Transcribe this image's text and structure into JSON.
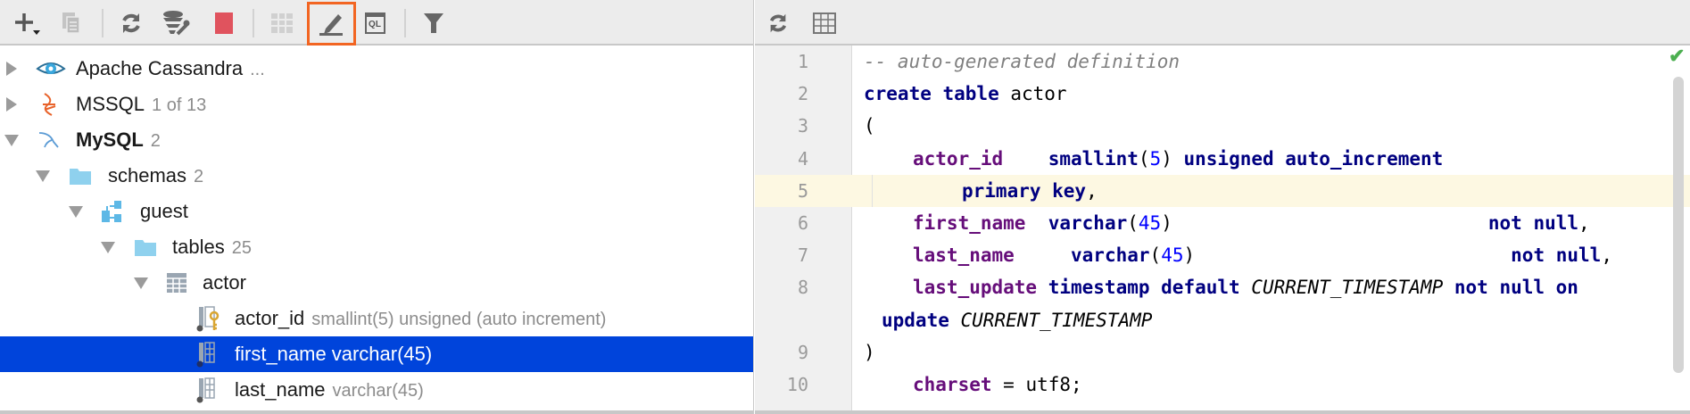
{
  "left_toolbar": {
    "buttons": [
      {
        "name": "add",
        "icon": "plus-icon"
      },
      {
        "name": "duplicate",
        "icon": "copy-icon"
      },
      {
        "name": "refresh",
        "icon": "refresh-icon"
      },
      {
        "name": "data-source-properties",
        "icon": "database-wrench-icon"
      },
      {
        "name": "stop",
        "icon": "stop-icon"
      },
      {
        "name": "table-view",
        "icon": "table-icon"
      },
      {
        "name": "edit-source",
        "icon": "pencil-icon",
        "highlighted": true
      },
      {
        "name": "console",
        "icon": "ql-console-icon",
        "label": "QL"
      },
      {
        "name": "filter",
        "icon": "filter-icon"
      }
    ],
    "highlight_color": "#f26522"
  },
  "tree": [
    {
      "label": "Apache Cassandra",
      "extra": "...",
      "icon": "cassandra-eye-icon",
      "expanded": false
    },
    {
      "label": "MSSQL",
      "extra": "1 of 13",
      "icon": "mssql-icon",
      "expanded": false
    },
    {
      "label": "MySQL",
      "extra": "2",
      "icon": "mysql-dolphin-icon",
      "expanded": true
    },
    {
      "label": "schemas",
      "extra": "2",
      "icon": "folder-icon",
      "expanded": true
    },
    {
      "label": "guest",
      "extra": "",
      "icon": "schema-icon",
      "expanded": true
    },
    {
      "label": "tables",
      "extra": "25",
      "icon": "folder-icon",
      "expanded": true
    },
    {
      "label": "actor",
      "extra": "",
      "icon": "table-icon",
      "expanded": true
    },
    {
      "label": "actor_id",
      "extra": "smallint(5) unsigned (auto increment)",
      "icon": "primary-key-column-icon"
    },
    {
      "label": "first_name",
      "extra": "varchar(45)",
      "icon": "column-icon",
      "selected": true
    },
    {
      "label": "last_name",
      "extra": "varchar(45)",
      "icon": "column-icon"
    }
  ],
  "selection_color": "#0044db",
  "editor": {
    "toolbar": [
      {
        "icon": "refresh-icon"
      },
      {
        "icon": "table-icon"
      }
    ],
    "status": "ok-checkmark",
    "line_numbers": [
      "1",
      "2",
      "3",
      "4",
      "5",
      "6",
      "7",
      "8",
      "9",
      "10"
    ],
    "tokens": {
      "l1": "-- auto-generated definition",
      "l2_kw": "create table",
      "l2_name": " actor",
      "l3": "(",
      "l4_col": "actor_id",
      "l4_sp": "    ",
      "l4_kw1": "smallint",
      "l4_p1": "(",
      "l4_n": "5",
      "l4_p2": ") ",
      "l4_kw2": "unsigned auto_increment",
      "l5_kw": "primary key",
      "l5_p": ",",
      "l6_col": "first_name",
      "l6_sp": "  ",
      "l6_kw": "varchar",
      "l6_p1": "(",
      "l6_n": "45",
      "l6_p2": ")",
      "l6_sp2": "                            ",
      "l6_kw2": "not null",
      "l6_c": ",",
      "l7_col": "last_name",
      "l7_sp": "     ",
      "l7_kw": "varchar",
      "l7_p1": "(",
      "l7_n": "45",
      "l7_p2": ")",
      "l7_sp2": "                            ",
      "l7_kw2": "not null",
      "l7_c": ",",
      "l8_col": "last_update",
      "l8_kw1": " timestamp default ",
      "l8_it": "CURRENT_TIMESTAMP",
      "l8_kw2": " not null on",
      "l8w_kw": "update ",
      "l8w_it": "CURRENT_TIMESTAMP",
      "l9": ")",
      "l10_col": "charset",
      "l10_rest": " = utf8;"
    }
  }
}
